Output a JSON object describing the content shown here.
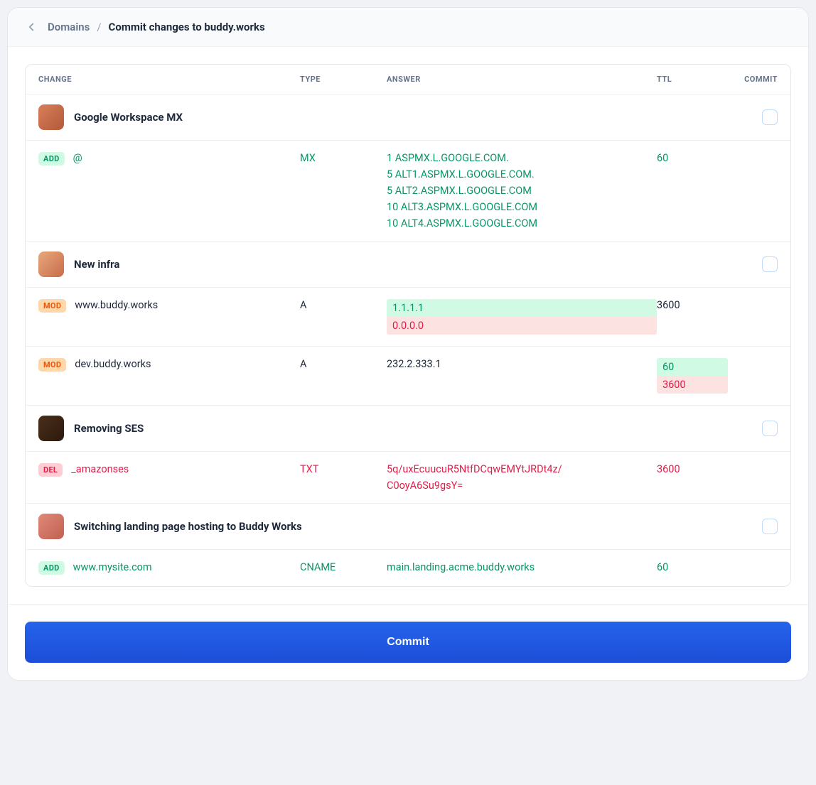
{
  "breadcrumb": {
    "link_label": "Domains",
    "separator": "/",
    "current": "Commit changes to buddy.works"
  },
  "columns": {
    "change": "CHANGE",
    "type": "TYPE",
    "answer": "ANSWER",
    "ttl": "TTL",
    "commit": "COMMIT"
  },
  "groups": [
    {
      "title": "Google Workspace MX",
      "avatar_class": "av1",
      "rows": [
        {
          "action": "ADD",
          "action_class": "add",
          "txt_class": "txt-add",
          "name": "@",
          "type": "MX",
          "answers": [
            "1 ASPMX.L.GOOGLE.COM.",
            "5 ALT1.ASPMX.L.GOOGLE.COM.",
            "5 ALT2.ASPMX.L.GOOGLE.COM",
            "10 ALT3.ASPMX.L.GOOGLE.COM",
            "10 ALT4.ASPMX.L.GOOGLE.COM"
          ],
          "ttl": "60"
        }
      ]
    },
    {
      "title": "New infra",
      "avatar_class": "av2",
      "rows": [
        {
          "action": "MOD",
          "action_class": "mod",
          "txt_class": "txt-mod",
          "name": "www.buddy.works",
          "type": "A",
          "answer_diff": {
            "added": "1.1.1.1",
            "removed": "0.0.0.0"
          },
          "ttl": "3600"
        },
        {
          "action": "MOD",
          "action_class": "mod",
          "txt_class": "txt-mod",
          "name": "dev.buddy.works",
          "type": "A",
          "answers": [
            "232.2.333.1"
          ],
          "ttl_diff": {
            "added": "60",
            "removed": "3600"
          }
        }
      ]
    },
    {
      "title": "Removing SES",
      "avatar_class": "av3",
      "rows": [
        {
          "action": "DEL",
          "action_class": "del",
          "txt_class": "txt-del",
          "name": "_amazonses",
          "type": "TXT",
          "answers": [
            "5q/uxEcuucuR5NtfDCqwEMYtJRDt4z/",
            "C0oyA6Su9gsY="
          ],
          "ttl": "3600"
        }
      ]
    },
    {
      "title": "Switching landing page hosting to Buddy Works",
      "avatar_class": "av4",
      "rows": [
        {
          "action": "ADD",
          "action_class": "add",
          "txt_class": "txt-add",
          "name": "www.mysite.com",
          "type": "CNAME",
          "answers": [
            "main.landing.acme.buddy.works"
          ],
          "ttl": "60"
        }
      ]
    }
  ],
  "commit_button": "Commit"
}
